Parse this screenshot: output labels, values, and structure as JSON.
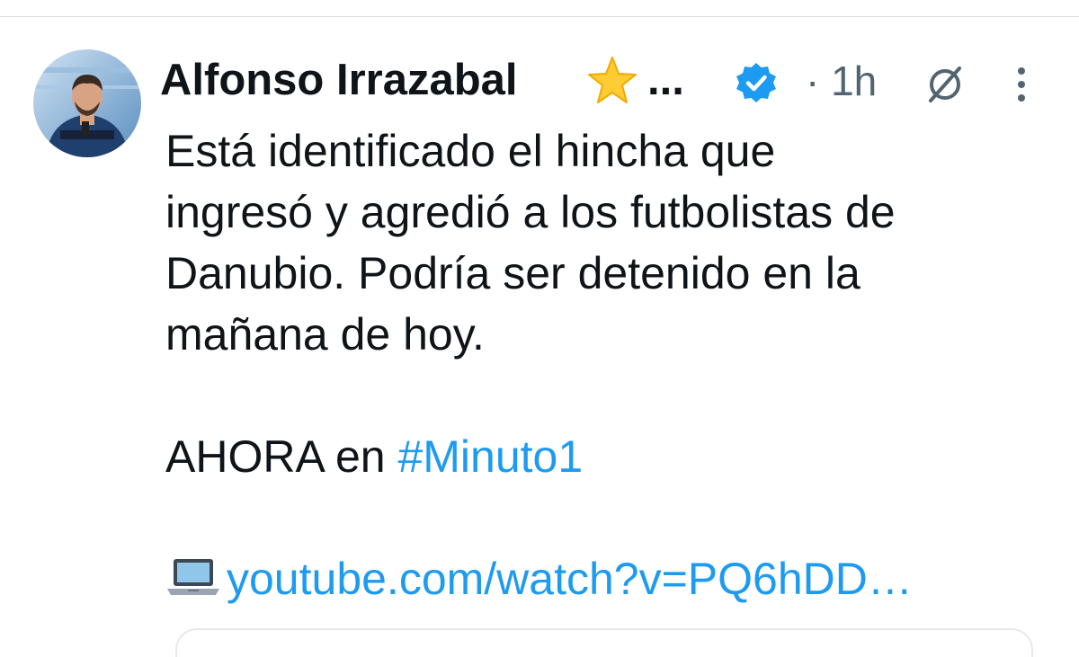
{
  "tweet": {
    "author_name": "Alfonso Irrazabal",
    "name_emoji": "star-emoji",
    "name_truncation": "...",
    "verified_icon": "verified-badge-icon",
    "time": "· 1h",
    "grok_icon": "grok-icon",
    "more_icon": "more-options-icon",
    "text_lines": [
      "Está identificado el hincha que",
      "ingresó y agredió a los futbolistas de",
      "Danubio. Podría ser detenido en la",
      "mañana de hoy."
    ],
    "now_prefix": "AHORA en ",
    "hashtag": "#Minuto1",
    "link_emoji": "laptop-emoji",
    "link_text": "youtube.com/watch?v=PQ6hDD…",
    "accent_color": "#1d9bf0",
    "verified_color": "#1d9bf0"
  }
}
